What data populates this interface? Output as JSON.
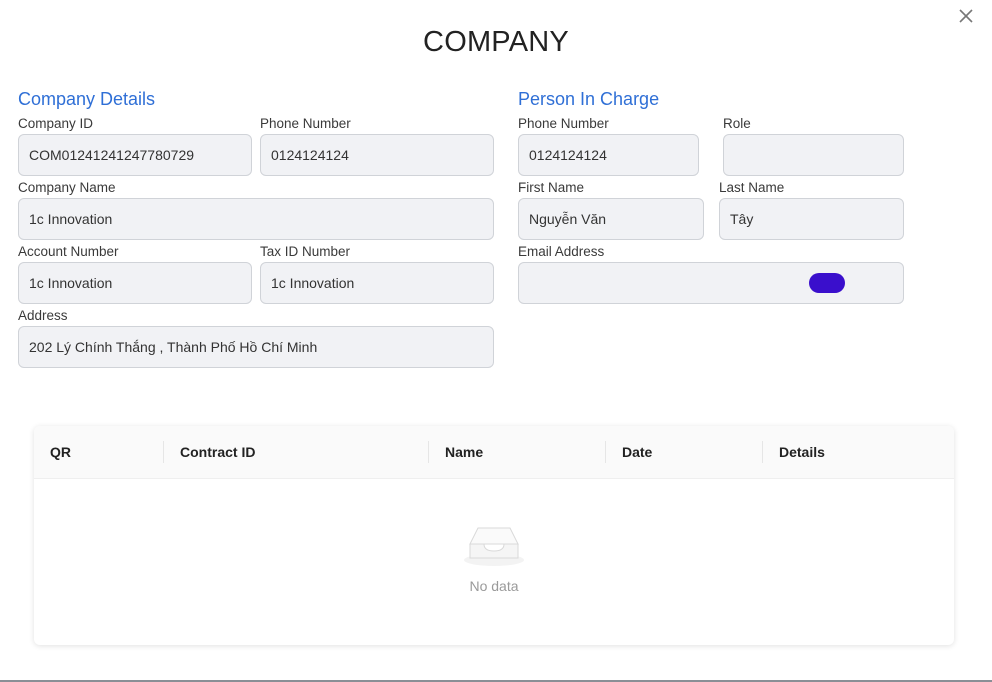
{
  "modal": {
    "title": "COMPANY"
  },
  "company": {
    "heading": "Company Details",
    "id": {
      "label": "Company ID",
      "value": "COM01241241247780729"
    },
    "phone": {
      "label": "Phone Number",
      "value": "0124124124"
    },
    "name": {
      "label": "Company Name",
      "value": "1c Innovation"
    },
    "account": {
      "label": "Account Number",
      "value": "1c Innovation"
    },
    "tax": {
      "label": "Tax ID Number",
      "value": "1c Innovation"
    },
    "address": {
      "label": "Address",
      "value": "202 Lý Chính Thắng , Thành Phố Hồ Chí Minh"
    }
  },
  "person": {
    "heading": "Person In Charge",
    "phone": {
      "label": "Phone Number",
      "value": "0124124124"
    },
    "role": {
      "label": "Role",
      "value": ""
    },
    "first_name": {
      "label": "First Name",
      "value": "Nguyễn Văn"
    },
    "last_name": {
      "label": "Last Name",
      "value": "Tây"
    },
    "email": {
      "label": "Email Address",
      "value": ""
    }
  },
  "table": {
    "columns": [
      "QR",
      "Contract ID",
      "Name",
      "Date",
      "Details"
    ],
    "rows": [],
    "empty_text": "No data"
  },
  "icons": {
    "close": "close-icon",
    "empty": "empty-inbox-icon"
  },
  "colors": {
    "accent": "#2f6fd6",
    "field_bg": "#f1f2f5",
    "redaction": "#3a0fcc"
  }
}
